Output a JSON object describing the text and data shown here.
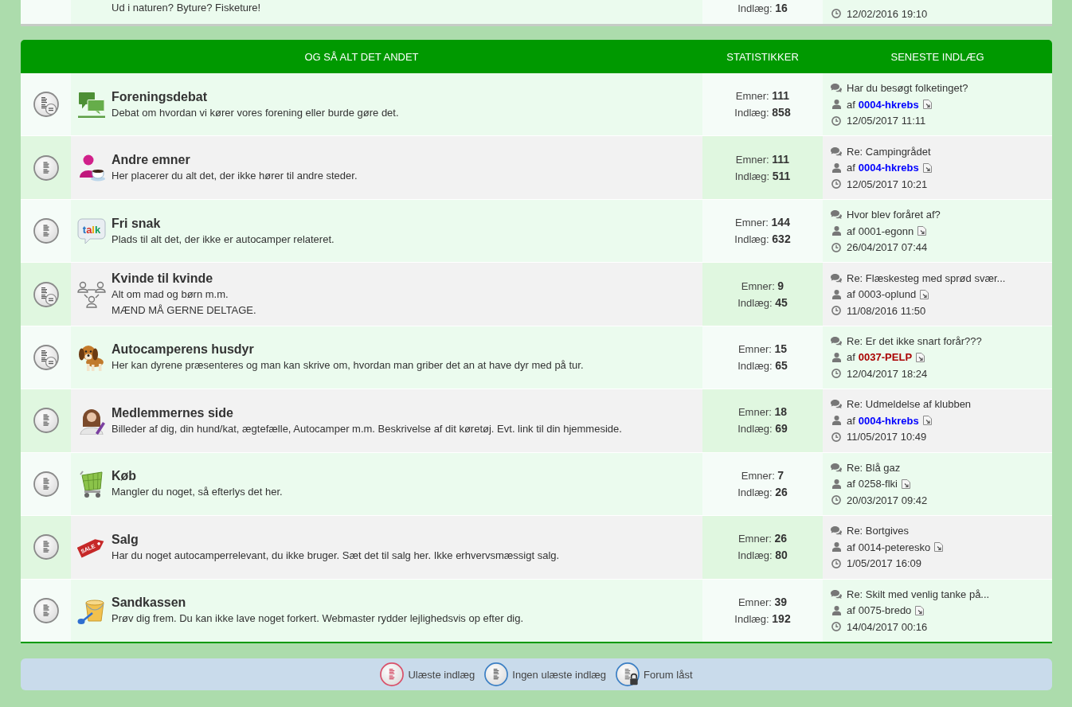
{
  "previous_section": {
    "last_row": {
      "description": "Ud i naturen? Byture? Fisketure!",
      "posts": "Indlæg: **16**",
      "last_post_date": "12/02/2016 19:10"
    }
  },
  "section": {
    "columns": [
      "OG SÅ ALT DET ANDET",
      "STATISTIKKER",
      "SENESTE INDLÆG"
    ],
    "forums": [
      {
        "title": "Foreningsdebat",
        "description": "Debat om hvordan vi kører vores forening eller burde gøre det.",
        "has_subforums": true,
        "topics": "Emner: **111**",
        "posts": "Indlæg: **858**",
        "last_post": {
          "title": "Har du besøgt folketinget?",
          "by": "af",
          "author": {
            "name": "0004-hkrebs",
            "color": "#0000ff"
          },
          "date": "12/05/2017 11:11"
        }
      },
      {
        "title": "Andre emner",
        "description": "Her placerer du alt det, der ikke hører til andre steder.",
        "has_subforums": false,
        "topics": "Emner: **111**",
        "posts": "Indlæg: **511**",
        "last_post": {
          "title": "Re: Campingrådet",
          "by": "af",
          "author": {
            "name": "0004-hkrebs",
            "color": "#0000ff"
          },
          "date": "12/05/2017 10:21"
        }
      },
      {
        "title": "Fri snak",
        "description": "Plads til alt det, der ikke er autocamper relateret.",
        "has_subforums": false,
        "icon_text": "talk",
        "topics": "Emner: **144**",
        "posts": "Indlæg: **632**",
        "last_post": {
          "title": "Hvor blev foråret af?",
          "by": "af",
          "author": {
            "name": "0001-egonn"
          },
          "date": "26/04/2017 07:44"
        }
      },
      {
        "title": "Kvinde til kvinde",
        "description": "Alt om mad og børn m.m.\nMÆND MÅ GERNE DELTAGE.",
        "has_subforums": true,
        "topics": "Emner: **9**",
        "posts": "Indlæg: **45**",
        "last_post": {
          "title": "Re: Flæskesteg med sprød svær...",
          "by": "af",
          "author": {
            "name": "0003-oplund"
          },
          "date": "11/08/2016 11:50"
        }
      },
      {
        "title": "Autocamperens husdyr",
        "description": "Her kan dyrene præsenteres og man kan skrive om, hvordan man griber det an at have dyr med på tur.",
        "has_subforums": true,
        "topics": "Emner: **15**",
        "posts": "Indlæg: **65**",
        "last_post": {
          "title": "Re: Er det ikke snart forår???",
          "by": "af",
          "author": {
            "name": "0037-PELP",
            "color": "#aa0000"
          },
          "date": "12/04/2017 18:24"
        }
      },
      {
        "title": "Medlemmernes side",
        "description": "Billeder af dig, din hund/kat, ægtefælle, Autocamper m.m. Beskrivelse af dit køretøj. Evt. link til din hjemmeside.",
        "has_subforums": false,
        "topics": "Emner: **18**",
        "posts": "Indlæg: **69**",
        "last_post": {
          "title": "Re: Udmeldelse af klubben",
          "by": "af",
          "author": {
            "name": "0004-hkrebs",
            "color": "#0000ff"
          },
          "date": "11/05/2017 10:49"
        }
      },
      {
        "title": "Køb",
        "description": "Mangler du noget, så efterlys det her.",
        "has_subforums": false,
        "topics": "Emner: **7**",
        "posts": "Indlæg: **26**",
        "last_post": {
          "title": "Re: Blå gaz",
          "by": "af",
          "author": {
            "name": "0258-flki"
          },
          "date": "20/03/2017 09:42"
        }
      },
      {
        "title": "Salg",
        "description": "Har du noget autocamperrelevant, du ikke bruger. Sæt det til salg her. Ikke erhvervsmæssigt salg.",
        "has_subforums": false,
        "icon_text": "SALE",
        "topics": "Emner: **26**",
        "posts": "Indlæg: **80**",
        "last_post": {
          "title": "Re: Bortgives",
          "by": "af",
          "author": {
            "name": "0014-peteresko"
          },
          "date": "1/05/2017 16:09"
        }
      },
      {
        "title": "Sandkassen",
        "description": "Prøv dig frem. Du kan ikke lave noget forkert. Webmaster rydder lejlighedsvis op efter dig.",
        "has_subforums": false,
        "topics": "Emner: **39**",
        "posts": "Indlæg: **192**",
        "last_post": {
          "title": "Re: Skilt med venlig tanke på...",
          "by": "af",
          "author": {
            "name": "0075-bredo"
          },
          "date": "14/04/2017 00:16"
        }
      }
    ]
  },
  "legend": [
    {
      "kind": "unread",
      "label": "Ulæste indlæg"
    },
    {
      "kind": "read",
      "label": "Ingen ulæste indlæg"
    },
    {
      "kind": "locked",
      "label": "Forum låst"
    }
  ]
}
